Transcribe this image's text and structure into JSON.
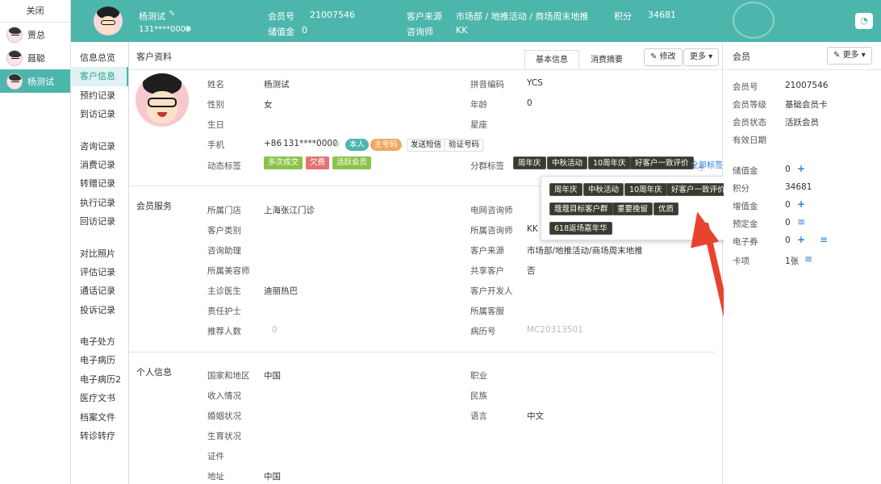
{
  "sessions": {
    "close_label": "关闭",
    "items": [
      {
        "name": "贾总"
      },
      {
        "name": "聂聪"
      },
      {
        "name": "杨测试"
      }
    ]
  },
  "header": {
    "name": "杨测试",
    "phone": "131****0000",
    "member_no_label": "会员号",
    "member_no": "21007546",
    "stored_label": "储值金",
    "stored_value": "0",
    "source_label": "客户来源",
    "source_value": "市场部 / 地推活动 / 商场周末地推",
    "consultant_label": "咨询师",
    "consultant_value": "KK",
    "points_label": "积分",
    "points_value": "34681"
  },
  "nav": {
    "group1": [
      "信息总览",
      "客户信息",
      "预约记录",
      "到访记录"
    ],
    "group2": [
      "咨询记录",
      "消费记录",
      "转赠记录",
      "执行记录",
      "回访记录"
    ],
    "group3": [
      "对比照片",
      "评估记录",
      "通话记录",
      "投诉记录"
    ],
    "group4": [
      "电子处方",
      "电子病历",
      "电子病历2",
      "医疗文书",
      "档案文件",
      "转诊转疗"
    ]
  },
  "main": {
    "title": "客户资料",
    "tab_basic": "基本信息",
    "tab_consume": "消费摘要",
    "edit_label": "修改",
    "more_label": "更多",
    "profile": {
      "name_label": "姓名",
      "name_value": "杨测试",
      "gender_label": "性别",
      "gender_value": "女",
      "birthday_label": "生日",
      "phone_label": "手机",
      "phone_code": "+86",
      "phone_value": "131****0000",
      "badge_self": "本人",
      "badge_main": "主号码",
      "sms_button": "发送短信",
      "verify_button": "验证号码",
      "dynamic_tags_label": "动态标签",
      "dynamic_tags": [
        "多次成交",
        "欠费",
        "活跃会员"
      ],
      "pinyin_label": "拼音编码",
      "pinyin_value": "YCS",
      "age_label": "年龄",
      "age_value": "0",
      "zodiac_label": "星座",
      "group_tags_label": "分群标签",
      "group_tags": [
        "周年庆",
        "中秋活动",
        "10周年庆",
        "好客户一致评价"
      ],
      "all_tags_link": "全部标签"
    },
    "service": {
      "title": "会员服务",
      "store_label": "所属门店",
      "store_value": "上海张江门诊",
      "type_label": "客户类别",
      "assistant_label": "咨询助理",
      "beautician_label": "所属美容师",
      "doctor_label": "主诊医生",
      "doctor_value": "迪丽热巴",
      "nurse_label": "责任护士",
      "referrals_label": "推荐人数",
      "referrals_value": "0",
      "net_consultant_label": "电网咨询师",
      "consultant_label": "所属咨询师",
      "consultant_value": "KK",
      "source_label": "客户来源",
      "source_value": "市场部/地推活动/商场周末地推",
      "shared_label": "共享客户",
      "shared_value": "否",
      "developer_label": "客户开发人",
      "cs_label": "所属客服",
      "record_label": "病历号",
      "record_value": "MC20313501"
    },
    "personal": {
      "title": "个人信息",
      "region_label": "国家和地区",
      "region_value": "中国",
      "income_label": "收入情况",
      "marital_label": "婚姻状况",
      "fertility_label": "生育状况",
      "id_label": "证件",
      "address_label": "地址",
      "address_value": "中国",
      "job_label": "职业",
      "ethnicity_label": "民族",
      "language_label": "语言",
      "language_value": "中文"
    },
    "popup_tags": [
      [
        "周年庆",
        "中秋活动",
        "10周年庆",
        "好客户一致评价"
      ],
      [
        "蔻蔻目标客户群",
        "重要挽留",
        "优质"
      ],
      [
        "618返场嘉年华"
      ]
    ]
  },
  "right": {
    "title": "会员",
    "more_label": "更多",
    "member_no_label": "会员号",
    "member_no_value": "21007546",
    "level_label": "会员等级",
    "level_value": "基础会员卡",
    "status_label": "会员状态",
    "status_value": "活跃会员",
    "expiry_label": "有效日期",
    "stored_label": "储值金",
    "stored_value": "0",
    "points_label": "积分",
    "points_value": "34681",
    "bonus_label": "增值金",
    "bonus_value": "0",
    "deposit_label": "预定金",
    "deposit_value": "0",
    "ecoupon_label": "电子券",
    "ecoupon_value": "0",
    "card_label": "卡项",
    "card_value": "1张"
  },
  "colors": {
    "accent": "#4db6ac",
    "link": "#2a7fd4",
    "arrow": "#e8432e",
    "tag_green": "#8bc34a",
    "tag_red": "#e57373",
    "tag_dark": "#3a3a2e"
  }
}
